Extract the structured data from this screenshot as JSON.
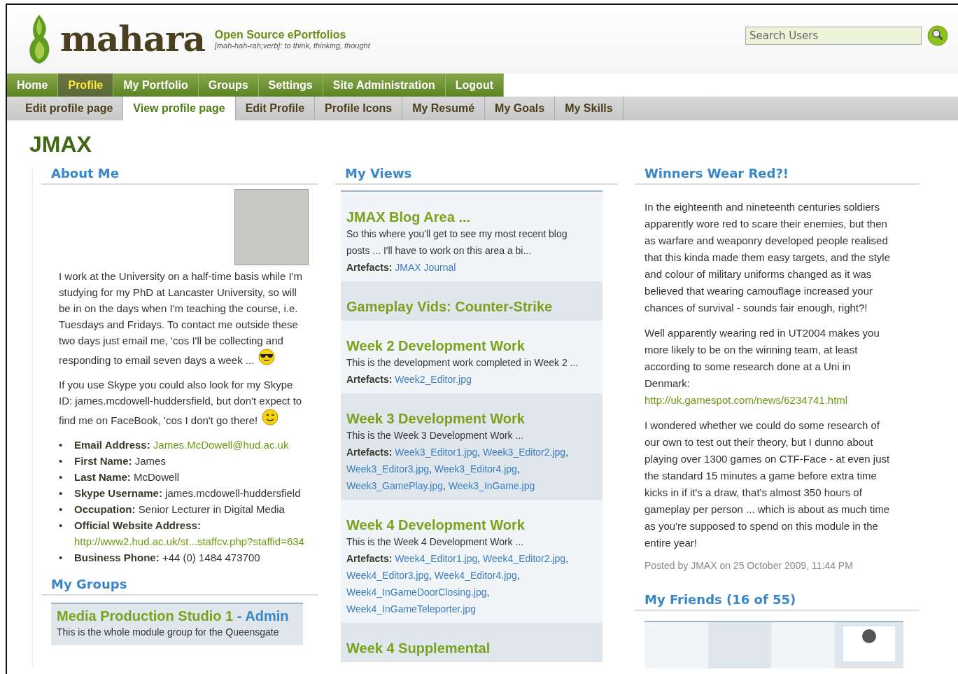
{
  "logo": {
    "name": "mahara",
    "tagline": "Open Source ePortfolios",
    "definition": "[mah-hah-rah;verb]: to think, thinking, thought"
  },
  "search": {
    "placeholder": "Search Users"
  },
  "main_nav": [
    {
      "label": "Home",
      "selected": false
    },
    {
      "label": "Profile",
      "selected": true
    },
    {
      "label": "My Portfolio",
      "selected": false
    },
    {
      "label": "Groups",
      "selected": false
    },
    {
      "label": "Settings",
      "selected": false
    },
    {
      "label": "Site Administration",
      "selected": false
    },
    {
      "label": "Logout",
      "selected": false
    }
  ],
  "sub_nav": [
    {
      "label": "Edit profile page",
      "selected": false
    },
    {
      "label": "View profile page",
      "selected": true
    },
    {
      "label": "Edit Profile",
      "selected": false
    },
    {
      "label": "Profile Icons",
      "selected": false
    },
    {
      "label": "My Resumé",
      "selected": false
    },
    {
      "label": "My Goals",
      "selected": false
    },
    {
      "label": "My Skills",
      "selected": false
    }
  ],
  "page_title": "JMAX",
  "about_me": {
    "title": "About Me",
    "paragraphs": [
      {
        "text": "I work at the University on a half-time basis while I'm studying for my PhD at Lancaster University, so will be in on the days when I'm teaching the course, i.e. Tuesdays and Fridays. To contact me outside these two days just email me, 'cos I'll be collecting and responding to email seven days a week ...",
        "kind": "cool"
      },
      {
        "text": "If you use Skype you could also look for my Skype ID: james.mcdowell-huddersfield, but don't expect to find me on FaceBook, 'cos I don't go there!",
        "kind": "wink"
      }
    ],
    "fields": [
      {
        "marker": "•",
        "label": "Email Address:",
        "value": "James.McDowell@hud.ac.uk",
        "kind": "link"
      },
      {
        "marker": "•",
        "label": "First Name:",
        "value": "James",
        "kind": "text"
      },
      {
        "marker": "•",
        "label": "Last Name:",
        "value": "McDowell",
        "kind": "text"
      },
      {
        "marker": "•",
        "label": "Skype Username:",
        "value": "james.mcdowell-huddersfield",
        "kind": "text"
      },
      {
        "marker": "•",
        "label": "Occupation:",
        "value": "Senior Lecturer in Digital Media",
        "kind": "text"
      },
      {
        "marker": "•",
        "label": "Official Website Address:",
        "value": "http://www2.hud.ac.uk/st...staffcv.php?staffid=634",
        "kind": "link_below"
      },
      {
        "marker": "•",
        "label": "Business Phone:",
        "value": "+44 (0) 1484 473700",
        "kind": "text"
      }
    ]
  },
  "my_groups": {
    "title": "My Groups",
    "groups": [
      {
        "name": "Media Production Studio 1",
        "role": "- Admin",
        "description": "This is the whole module group for the Queensgate"
      }
    ]
  },
  "my_views": {
    "title": "My Views",
    "views": [
      {
        "title": "JMAX Blog Area ...",
        "description": "So this where you'll get to see my most recent blog posts ... I'll have to work on this area a bi...",
        "artefacts_label": "Artefacts:",
        "artefacts": [
          "JMAX Journal"
        ]
      },
      {
        "title": "Gameplay Vids: Counter-Strike"
      },
      {
        "title": "Week 2 Development Work",
        "description": "This is the development work completed in Week 2 ...",
        "artefacts_label": "Artefacts:",
        "artefacts": [
          "Week2_Editor.jpg"
        ]
      },
      {
        "title": "Week 3 Development Work",
        "description": "This is the Week 3 Development Work ...",
        "artefacts_label": "Artefacts:",
        "separator": ",",
        "artefacts": [
          "Week3_Editor1.jpg",
          "Week3_Editor2.jpg",
          "Week3_Editor3.jpg",
          "Week3_Editor4.jpg",
          "Week3_GamePlay.jpg",
          "Week3_InGame.jpg"
        ]
      },
      {
        "title": "Week 4 Development Work",
        "description": "This is the Week 4 Development Work ...",
        "artefacts_label": "Artefacts:",
        "separator": ",",
        "artefacts": [
          "Week4_Editor1.jpg",
          "Week4_Editor2.jpg",
          "Week4_Editor3.jpg",
          "Week4_Editor4.jpg",
          "Week4_InGameDoorClosing.jpg",
          "Week4_InGameTeleporter.jpg"
        ]
      },
      {
        "title": "Week 4 Supplemental"
      }
    ]
  },
  "blog_post": {
    "title": "Winners Wear Red?!",
    "paragraphs": [
      {
        "text": "In the eighteenth and nineteenth centuries soldiers apparently wore red to scare their enemies, but then as warfare and weaponry developed people realised that this kinda made them easy targets, and the style and colour of military uniforms changed as it was believed that wearing camouflage increased your chances of survival - sounds fair enough, right?!"
      },
      {
        "text": "Well apparently wearing red in UT2004 makes you more likely to be on the winning team, at least according to some research done at a Uni in Denmark:",
        "link": "http://uk.gamespot.com/news/6234741.html"
      },
      {
        "text": "I wondered whether we could do some research of our own to test out their theory, but I dunno about playing over 1300 games on CTF-Face - at even just the standard 15 minutes a game before extra time kicks in if it's a draw, that's almost 350 hours of gameplay per person ... which is about as much time as you're supposed to spend on this module in the entire year!"
      }
    ],
    "posted": "Posted by JMAX on 25 October 2009, 11:44 PM"
  },
  "my_friends": {
    "title": "My Friends (16 of 55)",
    "tiles": [
      {
        "avatar": false
      },
      {
        "avatar": false
      },
      {
        "avatar": false
      },
      {
        "avatar": true
      }
    ]
  }
}
